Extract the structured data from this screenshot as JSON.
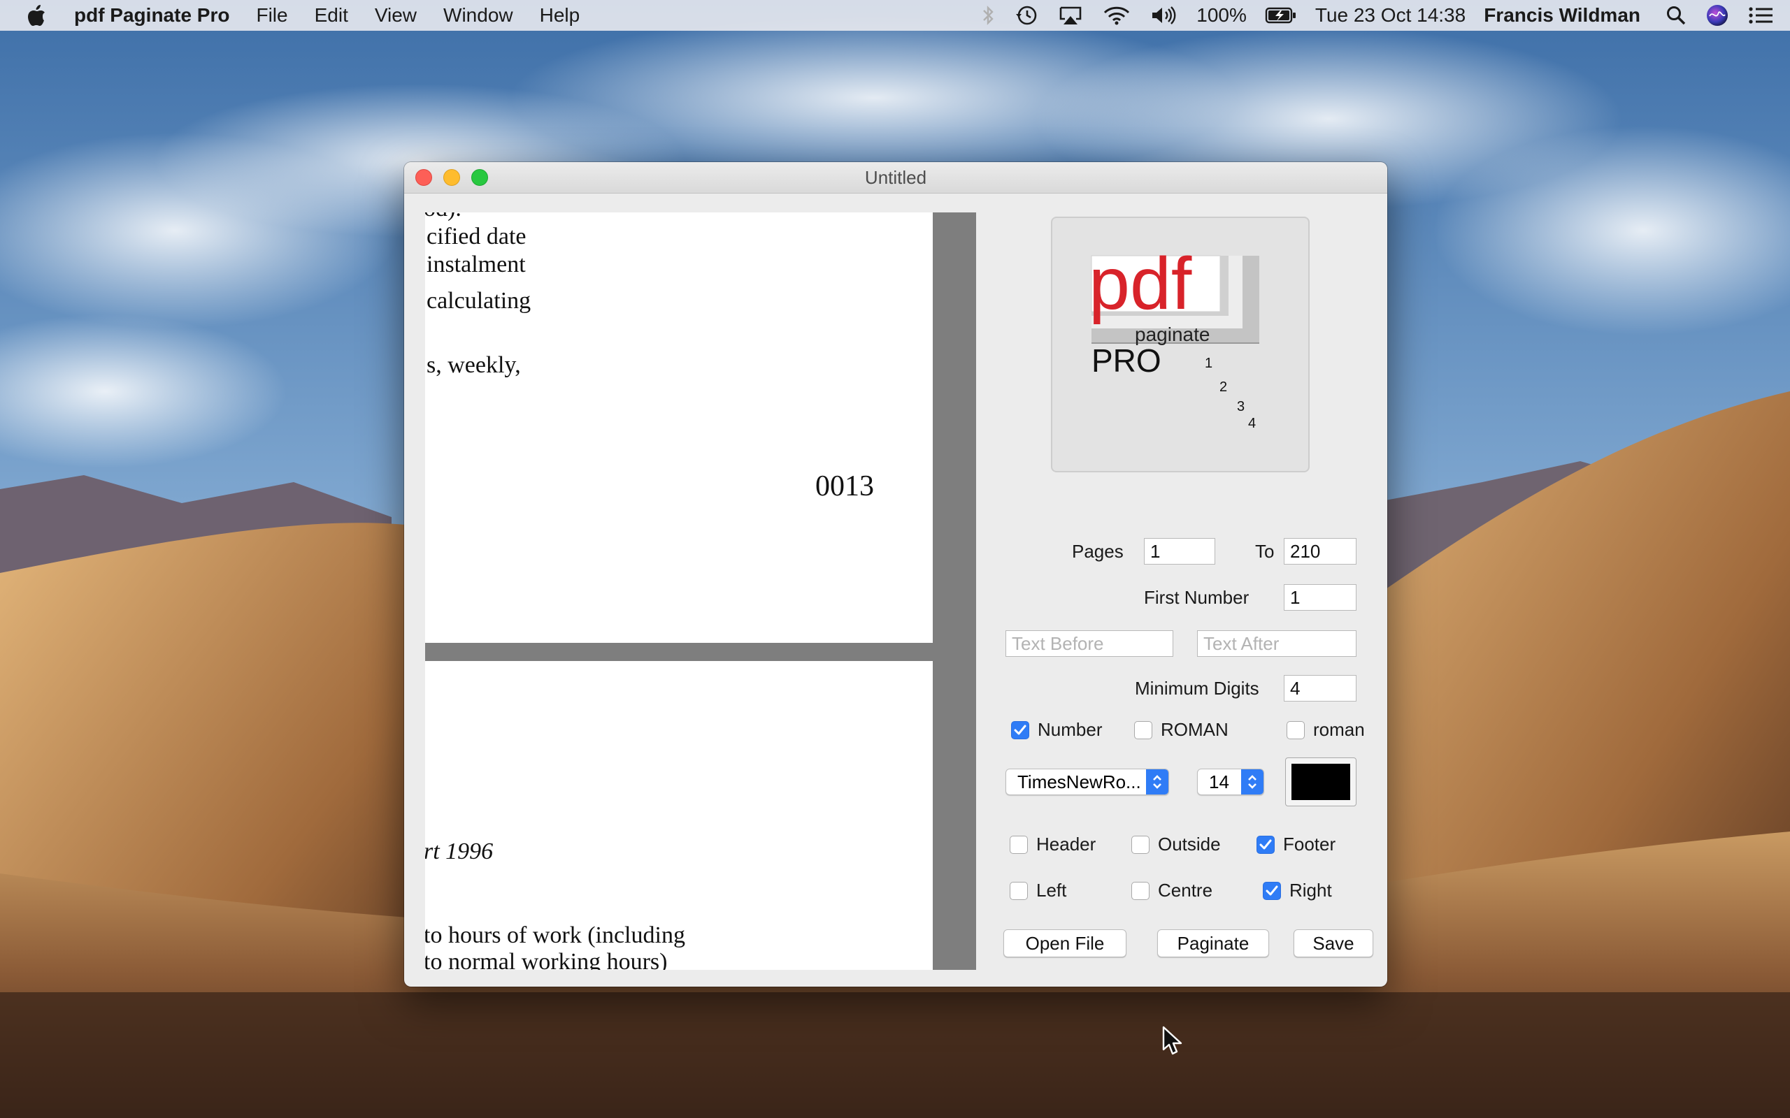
{
  "menubar": {
    "app_name": "pdf Paginate Pro",
    "menus": [
      "File",
      "Edit",
      "View",
      "Window",
      "Help"
    ],
    "battery": "100%",
    "datetime": "Tue 23 Oct  14:38",
    "user": "Francis Wildman",
    "icons": [
      "apple-icon",
      "bluetooth-icon",
      "time-machine-icon",
      "airplay-icon",
      "wifi-icon",
      "volume-icon",
      "battery-icon",
      "spotlight-icon",
      "siri-icon",
      "notification-center-icon"
    ]
  },
  "window": {
    "title": "Untitled"
  },
  "preview": {
    "page1_lines": [
      "od).",
      "cified date",
      "instalment",
      "calculating",
      "s,  weekly,"
    ],
    "page1_number": "0013",
    "page2_lines": [
      "rt 1996",
      "to hours of work (including",
      "to normal working hours)"
    ]
  },
  "logo": {
    "pdf": "pdf",
    "paginate": "paginate",
    "pro": "PRO",
    "n1": "1",
    "n2": "2",
    "n3": "3",
    "n4": "4",
    "pdf_color": "#d8232a"
  },
  "form": {
    "pages_label": "Pages",
    "pages_from": "1",
    "to_label": "To",
    "pages_to": "210",
    "first_number_label": "First Number",
    "first_number": "1",
    "text_before_placeholder": "Text Before",
    "text_after_placeholder": "Text After",
    "min_digits_label": "Minimum Digits",
    "min_digits": "4",
    "number_label": "Number",
    "roman_upper_label": "ROMAN",
    "roman_lower_label": "roman",
    "font_name": "TimesNewRo...",
    "font_size": "14",
    "color": "#000000",
    "header_label": "Header",
    "outside_label": "Outside",
    "footer_label": "Footer",
    "left_label": "Left",
    "centre_label": "Centre",
    "right_label": "Right",
    "checked": {
      "number": true,
      "roman_upper": false,
      "roman_lower": false,
      "header": false,
      "outside": false,
      "footer": true,
      "left": false,
      "centre": false,
      "right": true
    }
  },
  "buttons": {
    "open_file": "Open File",
    "paginate": "Paginate",
    "save": "Save"
  }
}
